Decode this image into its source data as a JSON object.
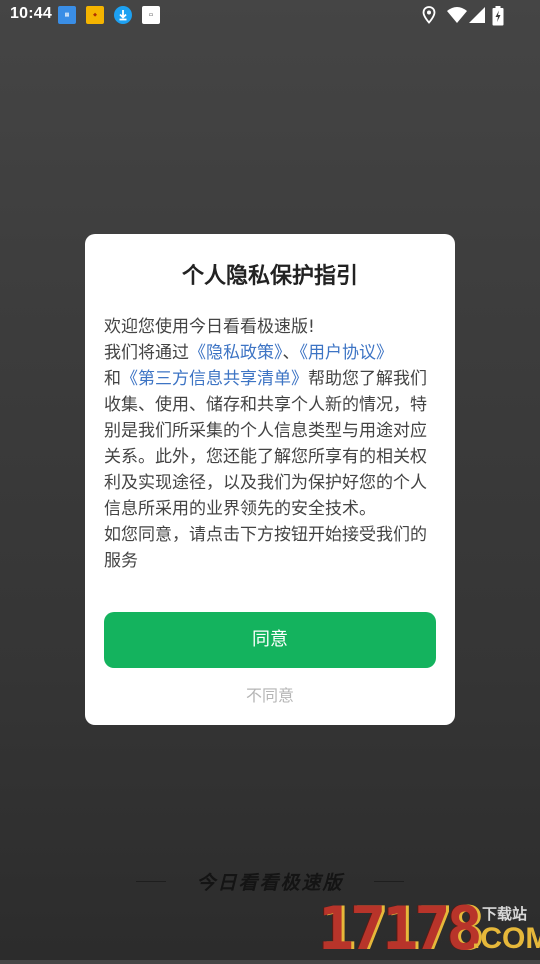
{
  "status_bar": {
    "time": "10:44",
    "notification_icons": [
      "news-app-icon",
      "reward-app-icon",
      "download-icon",
      "doc-app-icon"
    ],
    "system_icons": [
      "location-icon",
      "wifi-icon",
      "signal-icon",
      "battery-charging-icon"
    ]
  },
  "dialog": {
    "title": "个人隐私保护指引",
    "body": {
      "welcome": "欢迎您使用今日看看极速版!",
      "intro_prefix": "我们将通过",
      "privacy_link": "《隐私政策》",
      "separator": "、",
      "user_agreement_link": "《用户协议》",
      "and": "和",
      "third_party_link": "《第三方信息共享清单》",
      "description": "帮助您了解我们收集、使用、储存和共享个人新的情况，特别是我们所采集的个人信息类型与用途对应关系。此外，您还能了解您所享有的相关权利及实现途径，以及我们为保护好您的个人信息所采用的业界领先的安全技术。",
      "consent": "如您同意，请点击下方按钮开始接受我们的服务"
    },
    "agree_label": "同意",
    "disagree_label": "不同意"
  },
  "brand": {
    "app_name": "今日看看极速版"
  },
  "watermark": {
    "number": "17178",
    "sub": "下载站",
    "domain": ".COM"
  },
  "colors": {
    "accent_green": "#14b35e",
    "link_blue": "#3d74c4"
  }
}
